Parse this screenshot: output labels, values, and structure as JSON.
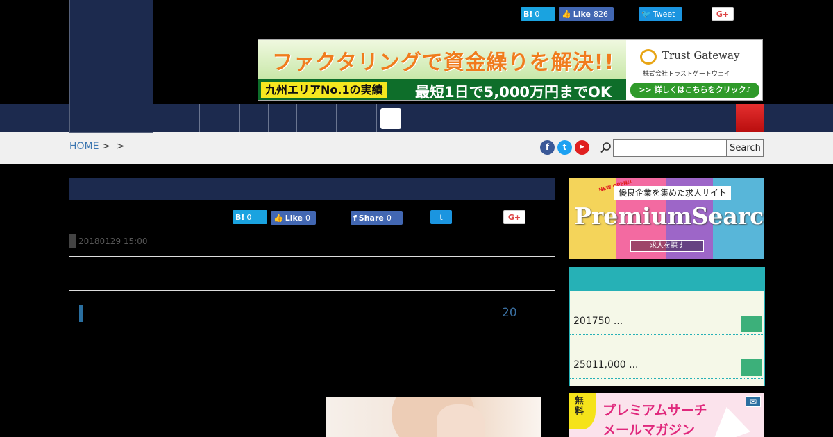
{
  "header": {
    "share_top": {
      "hatena": {
        "icon": "B!",
        "count": "0"
      },
      "facebook": {
        "label": "Like",
        "count": "826"
      },
      "twitter": {
        "label": "Tweet"
      },
      "google_plus": {
        "label": "G+"
      }
    },
    "banner": {
      "headline": "ファクタリングで資金繰りを解決!!",
      "sub1": "九州エリアNo.1の実績",
      "sub2": "最短1日で5,000万円までOK",
      "brand_name": "Trust Gateway",
      "brand_company": "株式会社トラストゲートウェイ",
      "cta": ">> 詳しくはこちらをクリック♪"
    }
  },
  "breadcrumb": {
    "home": "HOME",
    "sep1": ">",
    "sep2": ">"
  },
  "social": {
    "facebook": "f",
    "twitter": "t",
    "youtube": "▶"
  },
  "search": {
    "placeholder": "",
    "button_label": "Search"
  },
  "article": {
    "share": {
      "hatena": {
        "icon": "B!",
        "count": "0"
      },
      "facebook_like": {
        "label": "Like",
        "count": "0"
      },
      "facebook_share": {
        "label": "Share",
        "count": "0"
      },
      "twitter": {
        "label": "t"
      },
      "google_plus": {
        "label": "G+"
      }
    },
    "date": "20180129 15:00",
    "number": "20"
  },
  "sidebar": {
    "premium_ad": {
      "new_badge": "NEW OPEN!!",
      "tagline": "優良企業を集めた求人サイト",
      "title": "PremiumSearch",
      "button": "求人を探す"
    },
    "ranking": [
      {
        "text": "201750 ..."
      },
      {
        "text": "25011,000 ..."
      }
    ],
    "mail_ad": {
      "free": "無料",
      "line1": "プレミアムサーチ",
      "line2": "メールマガジン",
      "icon": "✉"
    }
  },
  "colors": {
    "navy": "#1c2a4e",
    "teal": "#26b1b6",
    "green_square": "#3cb07a",
    "nav_red": "#d81f1f"
  }
}
